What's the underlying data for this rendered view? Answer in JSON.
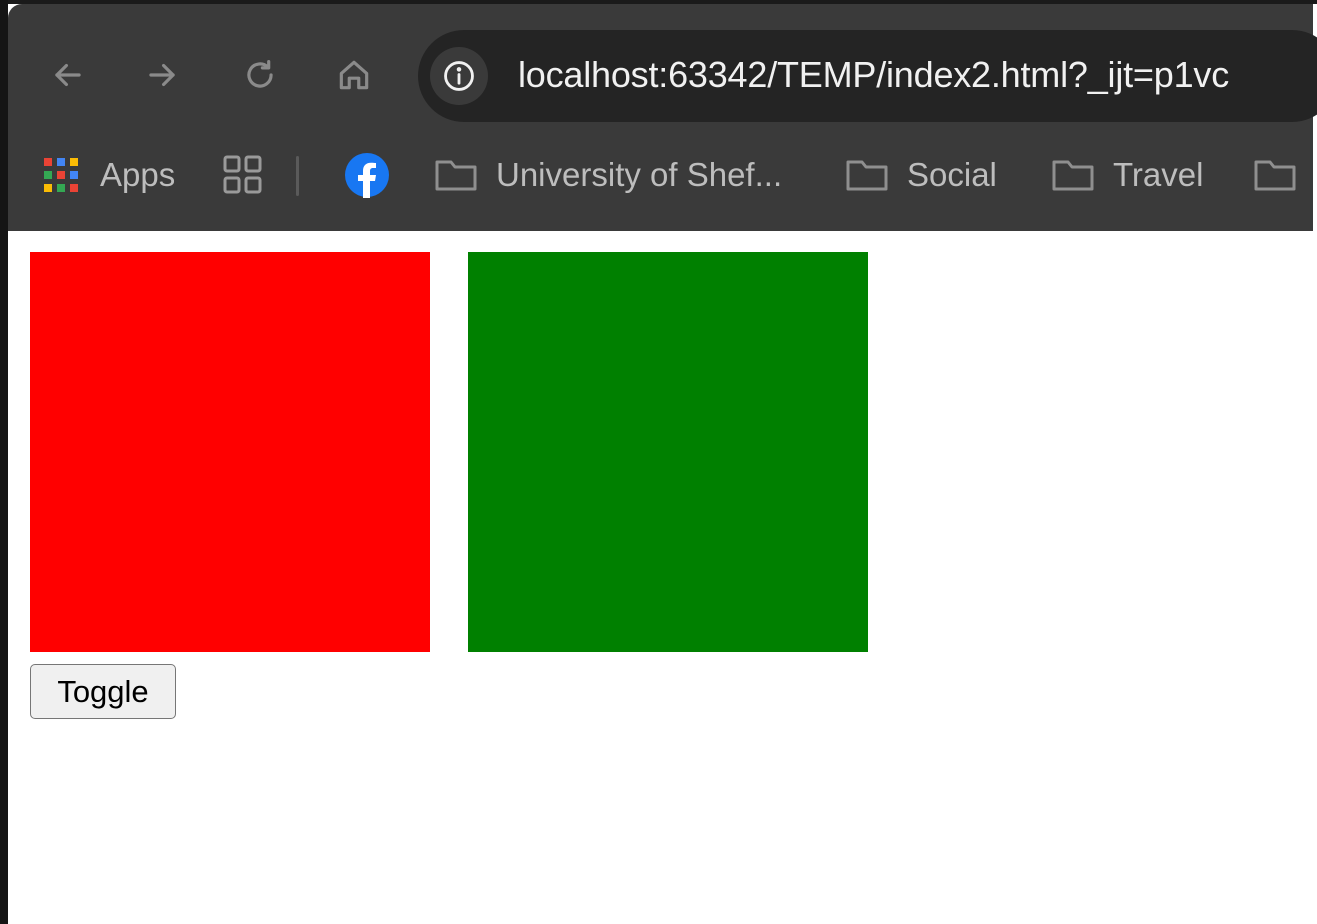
{
  "browser": {
    "url": "localhost:63342/TEMP/index2.html?_ijt=p1vc",
    "nav_icons": [
      "back-arrow-icon",
      "forward-arrow-icon",
      "reload-icon",
      "home-icon",
      "site-info-icon"
    ]
  },
  "bookmarks_bar": {
    "apps_label": "Apps",
    "items": [
      {
        "label": "University of Shef...",
        "icon": "folder-icon"
      },
      {
        "label": "Social",
        "icon": "folder-icon"
      },
      {
        "label": "Travel",
        "icon": "folder-icon"
      },
      {
        "label": "",
        "icon": "folder-icon"
      }
    ]
  },
  "page": {
    "boxes": [
      {
        "name": "red-box",
        "color": "#ff0000"
      },
      {
        "name": "green-box",
        "color": "#008000"
      }
    ],
    "toggle_label": "Toggle"
  },
  "colors": {
    "toolbar_bg": "#3a3a3a",
    "omnibox_bg": "#242424",
    "facebook_blue": "#1877f2"
  }
}
